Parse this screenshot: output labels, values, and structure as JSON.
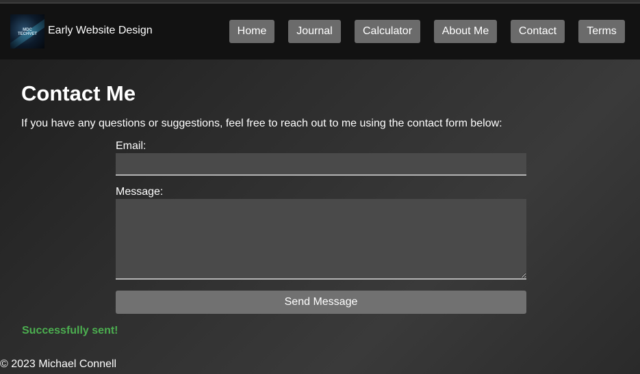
{
  "header": {
    "logo_text": "MDC TECHVET",
    "site_title": "Early Website Design",
    "nav": [
      {
        "label": "Home"
      },
      {
        "label": "Journal"
      },
      {
        "label": "Calculator"
      },
      {
        "label": "About Me"
      },
      {
        "label": "Contact"
      },
      {
        "label": "Terms"
      }
    ]
  },
  "main": {
    "title": "Contact Me",
    "intro": "If you have any questions or suggestions, feel free to reach out to me using the contact form below:",
    "form": {
      "email_label": "Email:",
      "email_value": "",
      "message_label": "Message:",
      "message_value": "",
      "submit_label": "Send Message"
    },
    "status_message": "Successfully sent!"
  },
  "footer": {
    "copyright": "© 2023 Michael Connell"
  },
  "colors": {
    "header_bg": "#121212",
    "nav_button_bg": "#6b6b6b",
    "success": "#4caf50"
  }
}
